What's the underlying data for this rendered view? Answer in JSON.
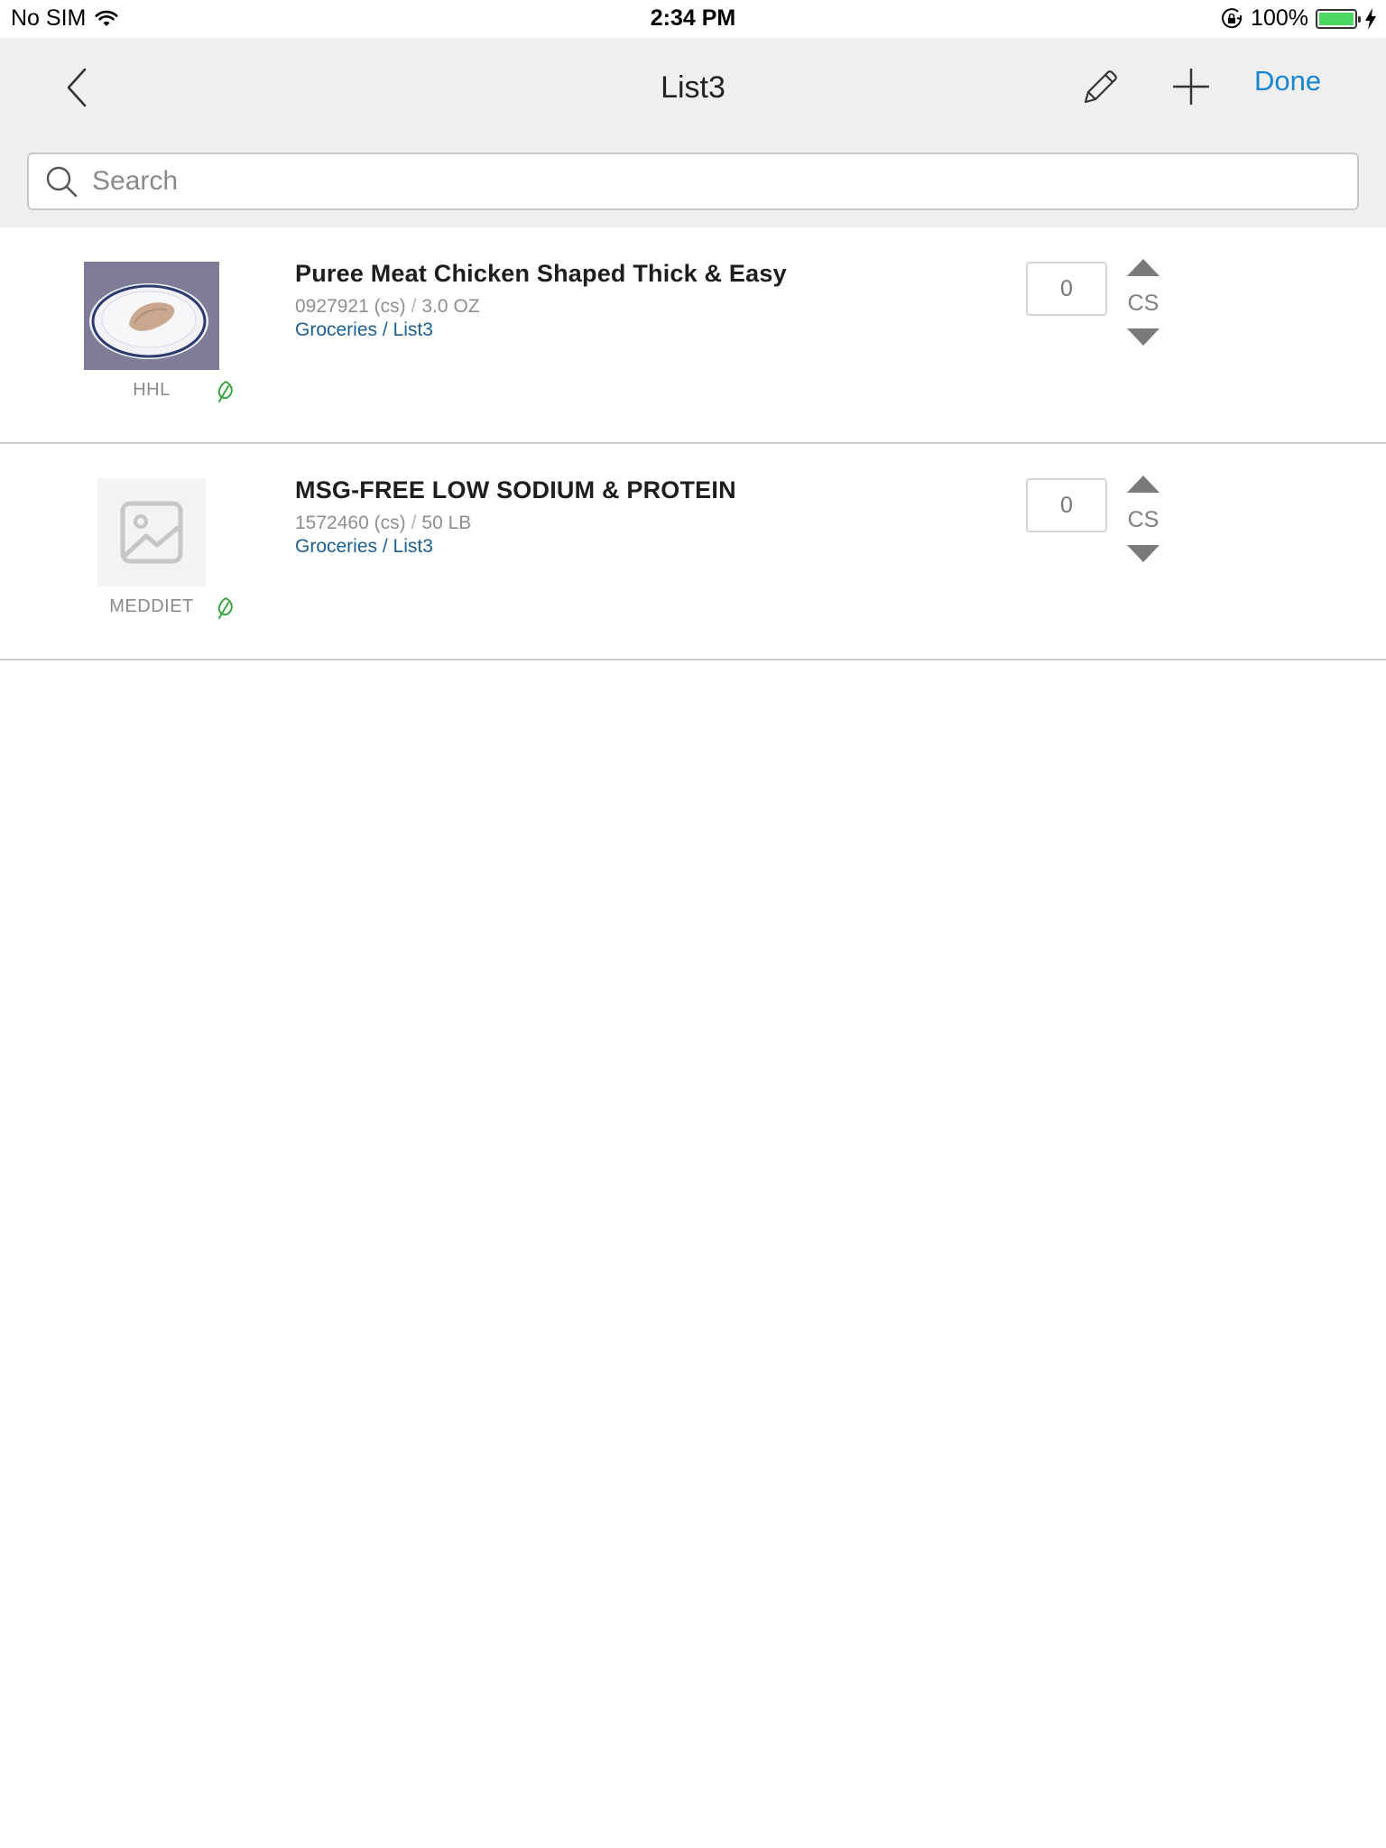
{
  "status_bar": {
    "carrier": "No SIM",
    "time": "2:34 PM",
    "battery_percent": "100%",
    "battery_level": 1.0,
    "icons": [
      "wifi-icon",
      "orientation-lock-icon",
      "battery-icon",
      "charging-bolt-icon"
    ]
  },
  "nav": {
    "title": "List3",
    "done_label": "Done",
    "accent_color": "#1a86cf",
    "icons": [
      "back-chevron-icon",
      "pencil-icon",
      "plus-icon"
    ]
  },
  "search": {
    "placeholder": "Search",
    "value": ""
  },
  "items": [
    {
      "name": "Puree Meat Chicken Shaped Thick & Easy",
      "item_number": "0927921 (cs)",
      "pack_size": "3.0 OZ",
      "category_path": "Groceries / List3",
      "brand": "HHL",
      "quantity": "0",
      "unit": "CS",
      "image": "chicken-on-plate-photo"
    },
    {
      "name": "MSG-FREE LOW SODIUM & PROTEIN",
      "item_number": "1572460 (cs)",
      "pack_size": "50 LB",
      "category_path": "Groceries / List3",
      "brand": "MEDDIET",
      "quantity": "0",
      "unit": "CS",
      "image": "image-placeholder-icon"
    }
  ]
}
